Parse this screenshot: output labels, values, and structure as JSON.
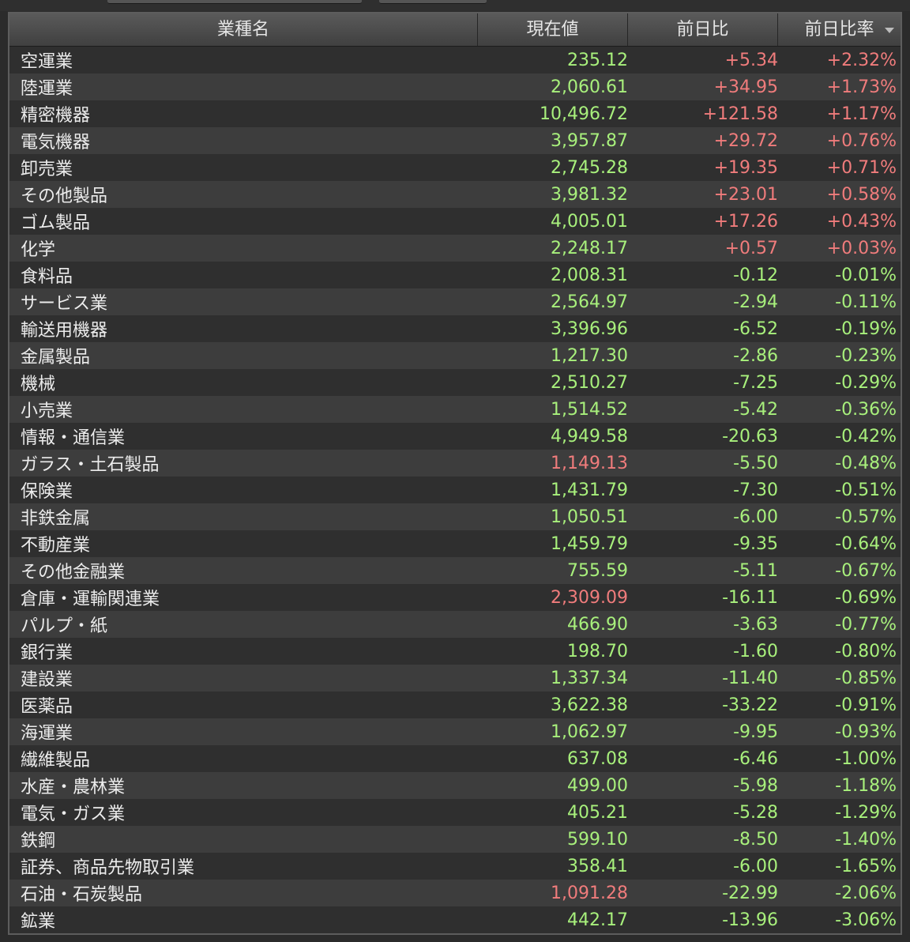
{
  "colors": {
    "up": "#f07c7c",
    "down": "#a8f07c",
    "header_text": "#e6e6e6",
    "row_text": "#ececec"
  },
  "table": {
    "headers": {
      "name": "業種名",
      "price": "現在値",
      "change": "前日比",
      "change_pct": "前日比率"
    },
    "sort_icon": "sort-descending-icon",
    "rows": [
      {
        "name": "空運業",
        "price": "235.12",
        "price_color": "green",
        "change": "+5.34",
        "change_pct": "+2.32%",
        "dir": "up"
      },
      {
        "name": "陸運業",
        "price": "2,060.61",
        "price_color": "green",
        "change": "+34.95",
        "change_pct": "+1.73%",
        "dir": "up"
      },
      {
        "name": "精密機器",
        "price": "10,496.72",
        "price_color": "green",
        "change": "+121.58",
        "change_pct": "+1.17%",
        "dir": "up"
      },
      {
        "name": "電気機器",
        "price": "3,957.87",
        "price_color": "green",
        "change": "+29.72",
        "change_pct": "+0.76%",
        "dir": "up"
      },
      {
        "name": "卸売業",
        "price": "2,745.28",
        "price_color": "green",
        "change": "+19.35",
        "change_pct": "+0.71%",
        "dir": "up"
      },
      {
        "name": "その他製品",
        "price": "3,981.32",
        "price_color": "green",
        "change": "+23.01",
        "change_pct": "+0.58%",
        "dir": "up"
      },
      {
        "name": "ゴム製品",
        "price": "4,005.01",
        "price_color": "green",
        "change": "+17.26",
        "change_pct": "+0.43%",
        "dir": "up"
      },
      {
        "name": "化学",
        "price": "2,248.17",
        "price_color": "green",
        "change": "+0.57",
        "change_pct": "+0.03%",
        "dir": "up"
      },
      {
        "name": "食料品",
        "price": "2,008.31",
        "price_color": "green",
        "change": "-0.12",
        "change_pct": "-0.01%",
        "dir": "down"
      },
      {
        "name": "サービス業",
        "price": "2,564.97",
        "price_color": "green",
        "change": "-2.94",
        "change_pct": "-0.11%",
        "dir": "down"
      },
      {
        "name": "輸送用機器",
        "price": "3,396.96",
        "price_color": "green",
        "change": "-6.52",
        "change_pct": "-0.19%",
        "dir": "down"
      },
      {
        "name": "金属製品",
        "price": "1,217.30",
        "price_color": "green",
        "change": "-2.86",
        "change_pct": "-0.23%",
        "dir": "down"
      },
      {
        "name": "機械",
        "price": "2,510.27",
        "price_color": "green",
        "change": "-7.25",
        "change_pct": "-0.29%",
        "dir": "down"
      },
      {
        "name": "小売業",
        "price": "1,514.52",
        "price_color": "green",
        "change": "-5.42",
        "change_pct": "-0.36%",
        "dir": "down"
      },
      {
        "name": "情報・通信業",
        "price": "4,949.58",
        "price_color": "green",
        "change": "-20.63",
        "change_pct": "-0.42%",
        "dir": "down"
      },
      {
        "name": "ガラス・土石製品",
        "price": "1,149.13",
        "price_color": "red",
        "change": "-5.50",
        "change_pct": "-0.48%",
        "dir": "down"
      },
      {
        "name": "保険業",
        "price": "1,431.79",
        "price_color": "green",
        "change": "-7.30",
        "change_pct": "-0.51%",
        "dir": "down"
      },
      {
        "name": "非鉄金属",
        "price": "1,050.51",
        "price_color": "green",
        "change": "-6.00",
        "change_pct": "-0.57%",
        "dir": "down"
      },
      {
        "name": "不動産業",
        "price": "1,459.79",
        "price_color": "green",
        "change": "-9.35",
        "change_pct": "-0.64%",
        "dir": "down"
      },
      {
        "name": "その他金融業",
        "price": "755.59",
        "price_color": "green",
        "change": "-5.11",
        "change_pct": "-0.67%",
        "dir": "down"
      },
      {
        "name": "倉庫・運輸関連業",
        "price": "2,309.09",
        "price_color": "red",
        "change": "-16.11",
        "change_pct": "-0.69%",
        "dir": "down"
      },
      {
        "name": "パルプ・紙",
        "price": "466.90",
        "price_color": "green",
        "change": "-3.63",
        "change_pct": "-0.77%",
        "dir": "down"
      },
      {
        "name": "銀行業",
        "price": "198.70",
        "price_color": "green",
        "change": "-1.60",
        "change_pct": "-0.80%",
        "dir": "down"
      },
      {
        "name": "建設業",
        "price": "1,337.34",
        "price_color": "green",
        "change": "-11.40",
        "change_pct": "-0.85%",
        "dir": "down"
      },
      {
        "name": "医薬品",
        "price": "3,622.38",
        "price_color": "green",
        "change": "-33.22",
        "change_pct": "-0.91%",
        "dir": "down"
      },
      {
        "name": "海運業",
        "price": "1,062.97",
        "price_color": "green",
        "change": "-9.95",
        "change_pct": "-0.93%",
        "dir": "down"
      },
      {
        "name": "繊維製品",
        "price": "637.08",
        "price_color": "green",
        "change": "-6.46",
        "change_pct": "-1.00%",
        "dir": "down"
      },
      {
        "name": "水産・農林業",
        "price": "499.00",
        "price_color": "green",
        "change": "-5.98",
        "change_pct": "-1.18%",
        "dir": "down"
      },
      {
        "name": "電気・ガス業",
        "price": "405.21",
        "price_color": "green",
        "change": "-5.28",
        "change_pct": "-1.29%",
        "dir": "down"
      },
      {
        "name": "鉄鋼",
        "price": "599.10",
        "price_color": "green",
        "change": "-8.50",
        "change_pct": "-1.40%",
        "dir": "down"
      },
      {
        "name": "証券、商品先物取引業",
        "price": "358.41",
        "price_color": "green",
        "change": "-6.00",
        "change_pct": "-1.65%",
        "dir": "down"
      },
      {
        "name": "石油・石炭製品",
        "price": "1,091.28",
        "price_color": "red",
        "change": "-22.99",
        "change_pct": "-2.06%",
        "dir": "down"
      },
      {
        "name": "鉱業",
        "price": "442.17",
        "price_color": "green",
        "change": "-13.96",
        "change_pct": "-3.06%",
        "dir": "down"
      }
    ]
  }
}
